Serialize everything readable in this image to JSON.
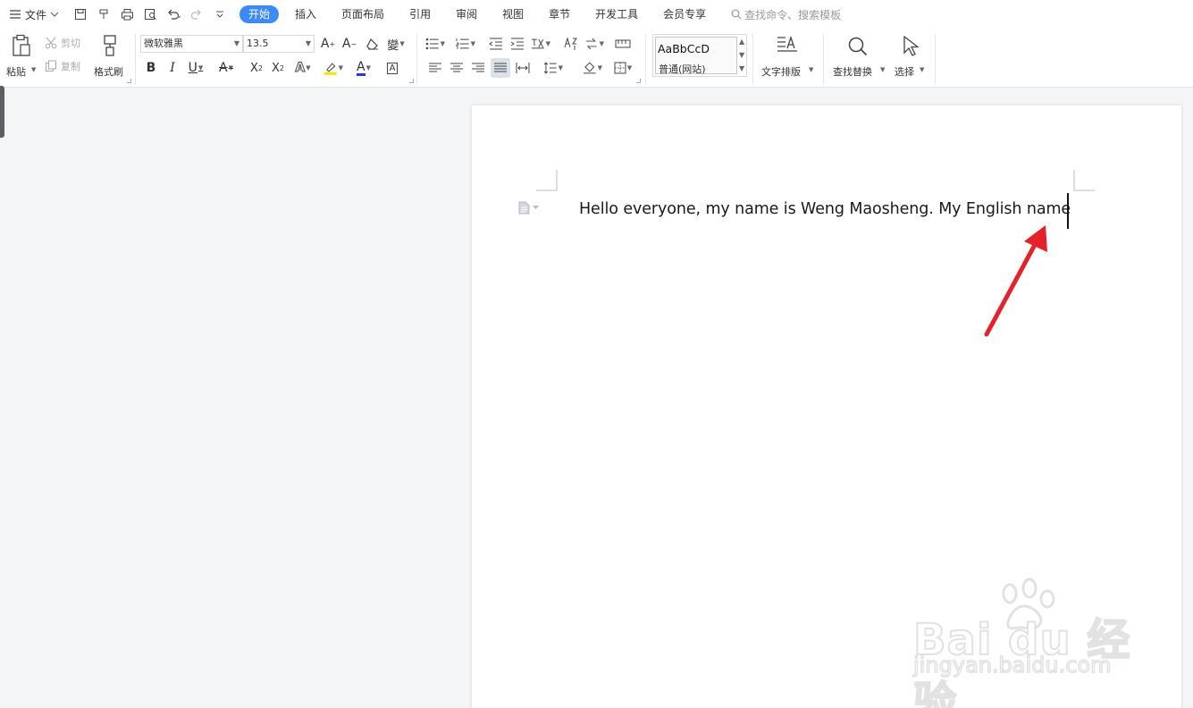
{
  "menubar": {
    "file_label": "文件",
    "tabs": [
      "开始",
      "插入",
      "页面布局",
      "引用",
      "审阅",
      "视图",
      "章节",
      "开发工具",
      "会员专享"
    ],
    "search_placeholder": "查找命令、搜索模板"
  },
  "ribbon": {
    "paste_label": "粘贴",
    "cut_label": "剪切",
    "copy_label": "复制",
    "format_painter_label": "格式刷",
    "font_name": "微软雅黑",
    "font_size": "13.5",
    "style_preview": "AaBbCcD",
    "style_name": "普通(网站)",
    "text_layout_label": "文字排版",
    "find_replace_label": "查找替换",
    "select_label": "选择"
  },
  "document": {
    "text": "Hello everyone, my name is Weng Maosheng. My English name"
  },
  "watermark": {
    "brand": "Bai du 经验",
    "url": "jingyan.baidu.com"
  },
  "colors": {
    "accent": "#3d8af7",
    "highlight": "#f5e400",
    "font_color": "#1f3fd1",
    "arrow": "#e5222a"
  }
}
